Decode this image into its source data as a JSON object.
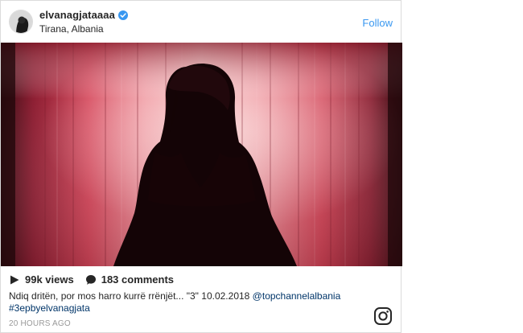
{
  "post": {
    "username": "elvanagjataaaa",
    "location": "Tirana, Albania",
    "follow_label": "Follow",
    "views": "99k views",
    "comments": "183 comments",
    "caption_text": "Ndiq dritën, por mos harro kurrë rrënjët... \"3\" 10.02.2018 ",
    "mention": "@topchannelalbania",
    "hashtag": "#3epbyelvanagjata",
    "time_ago": "20 HOURS AGO"
  },
  "icons": {
    "verified": "verified-badge-icon",
    "play": "play-icon",
    "comment": "comment-bubble-icon",
    "instagram": "instagram-glyph-icon"
  },
  "colors": {
    "link_blue": "#3897f0",
    "mention_link": "#003569",
    "curtain_red": "#d23c50",
    "border": "#dbdbdb",
    "muted_text": "#999999"
  }
}
